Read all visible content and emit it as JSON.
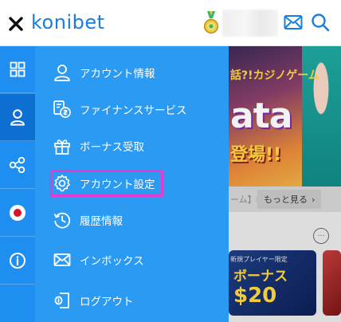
{
  "header": {
    "logo_text": "konibet",
    "icons": [
      "close-icon",
      "medal-icon",
      "mail-icon",
      "search-icon"
    ]
  },
  "rail": {
    "items": [
      {
        "icon": "grid-icon"
      },
      {
        "icon": "user-icon",
        "active": true
      },
      {
        "icon": "share-icon"
      },
      {
        "icon": "japan-flag-icon"
      },
      {
        "icon": "info-icon"
      }
    ]
  },
  "menu": {
    "items": [
      {
        "label": "アカウント情報",
        "icon": "user-icon"
      },
      {
        "label": "ファイナンスサービス",
        "icon": "finance-icon"
      },
      {
        "label": "ボーナス受取",
        "icon": "gift-icon"
      },
      {
        "label": "アカウント設定",
        "icon": "gear-icon",
        "highlighted": true
      },
      {
        "label": "履歴情報",
        "icon": "history-icon"
      },
      {
        "label": "インボックス",
        "icon": "mail-icon"
      },
      {
        "label": "ログアウト",
        "icon": "logout-icon"
      }
    ],
    "highlight_color": "#e93ad0"
  },
  "background": {
    "banner": {
      "line1": "話?!カジノゲーム",
      "big": "ata",
      "line2": "登場!!"
    },
    "tab_partial": "ーム】F",
    "more_label": "もっと見る",
    "dots": "···",
    "card": {
      "small_text": "新規プレイヤー限定",
      "title": "ボーナス",
      "amount": "$20"
    }
  },
  "colors": {
    "brand": "#1a7dde",
    "rail": "#1f8ef1",
    "panel": "#2b9af3"
  }
}
